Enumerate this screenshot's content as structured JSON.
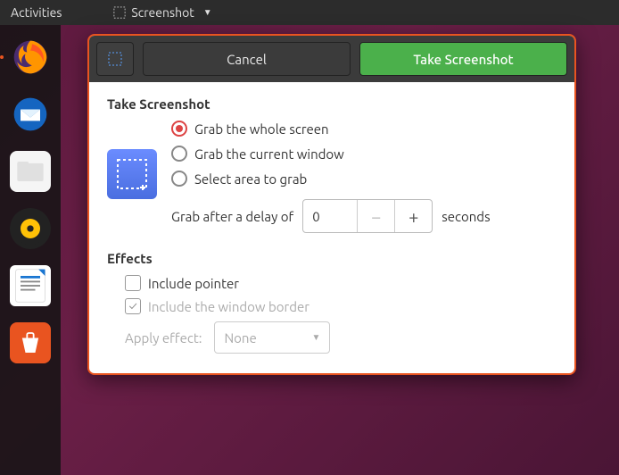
{
  "topbar": {
    "activities": "Activities",
    "app_name": "Screenshot"
  },
  "window": {
    "cancel": "Cancel",
    "take": "Take Screenshot",
    "section_capture": "Take Screenshot",
    "radio_whole": "Grab the whole screen",
    "radio_window": "Grab the current window",
    "radio_area": "Select area to grab",
    "delay_prefix": "Grab after a delay of",
    "delay_value": "0",
    "delay_suffix": "seconds",
    "section_effects": "Effects",
    "include_pointer": "Include pointer",
    "include_border": "Include the window border",
    "apply_effect_label": "Apply effect:",
    "apply_effect_value": "None"
  }
}
